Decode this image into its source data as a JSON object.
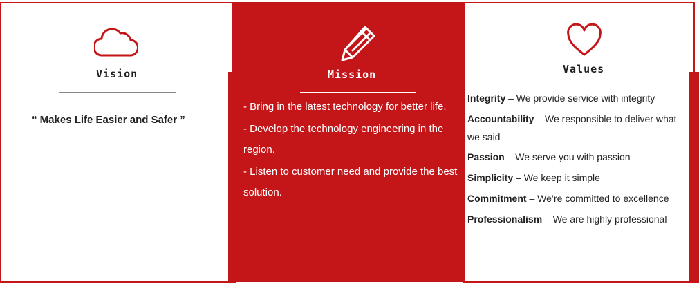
{
  "colors": {
    "accent": "#c41619",
    "rule": "#888888",
    "text": "#222222"
  },
  "vision": {
    "icon": "cloud-icon",
    "title": "Vision",
    "text": "“ Makes Life Easier and Safer ”"
  },
  "mission": {
    "icon": "pencil-icon",
    "title": "Mission",
    "items": [
      "- Bring in the latest technology for better life.",
      "- Develop the technology engineering in the region.",
      "- Listen to customer need and provide the best solution."
    ]
  },
  "values": {
    "icon": "heart-icon",
    "title": "Values",
    "items": [
      {
        "term": "Integrity",
        "desc": " – We provide service with integrity"
      },
      {
        "term": "Accountability",
        "desc": " – We responsible to deliver what we said"
      },
      {
        "term": "Passion",
        "desc": " – We serve you with passion"
      },
      {
        "term": "Simplicity",
        "desc": " – We keep it simple"
      },
      {
        "term": "Commitment",
        "desc": " – We’re committed to excellence"
      },
      {
        "term": "Professionalism",
        "desc": " – We are highly professional"
      }
    ]
  }
}
